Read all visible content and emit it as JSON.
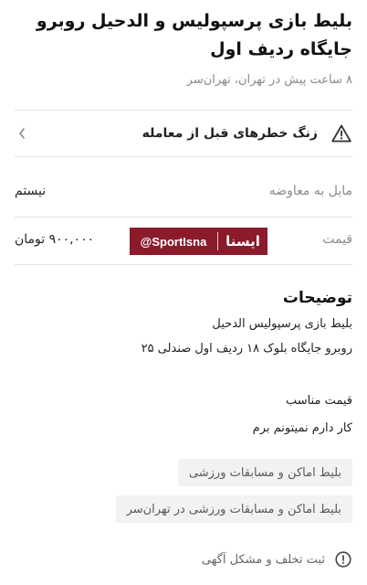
{
  "ad": {
    "title": "بلیط بازی پرسپولیس و الدحیل روبرو جایگاه ردیف اول",
    "posted": "۸ ساعت پیش در تهران، تهران‌سر"
  },
  "warning": {
    "label": "زنگ خطرهای قبل از معامله",
    "icon": "warning-triangle-icon",
    "arrow_icon": "chevron-left-icon"
  },
  "details": {
    "negotiation_key": "مایل به معاوضه",
    "negotiation_value": "نیستم",
    "price_key": "قیمت",
    "price_value": "۹۰۰,۰۰۰ تومان"
  },
  "watermark": {
    "handle": "@SportIsna",
    "brand": "ایسنا",
    "color": "#8b1a2b"
  },
  "description": {
    "heading": "توضیحات",
    "lines": [
      "بلیط بازی پرسپولیس الدحیل",
      "روبرو جایگاه بلوک ۱۸ ردیف اول صندلی ۲۵",
      "قیمت مناسب",
      "کار دارم نمیتونم برم"
    ]
  },
  "tags": [
    "بلیط اماکن و مسابقات ورزشی",
    "بلیط اماکن و مسابقات ورزشی در تهران‌سر"
  ],
  "report": {
    "label": "ثبت تخلف و مشکل آگهی",
    "icon": "alert-circle-icon"
  }
}
